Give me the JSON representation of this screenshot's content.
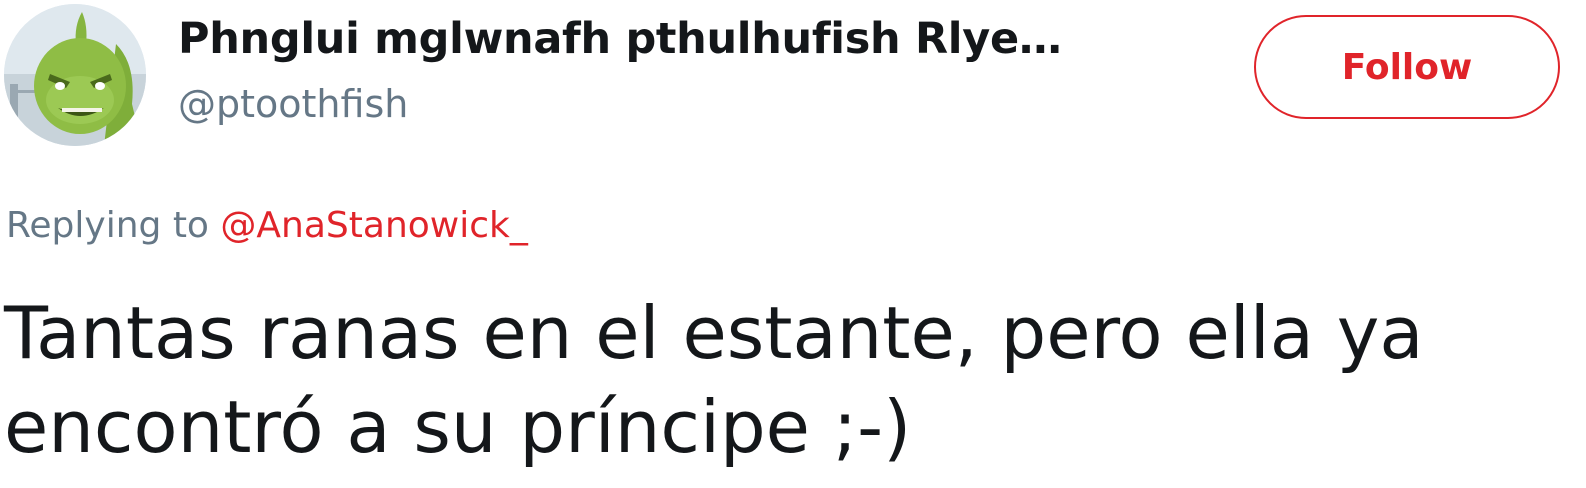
{
  "author": {
    "display_name": "Phnglui mglwnafh pthulhufish Rlye…",
    "handle": "@ptoothfish",
    "avatar_icon": "green-creature-avatar"
  },
  "follow_button": {
    "label": "Follow",
    "color": "#e0242a"
  },
  "reply": {
    "prefix": "Replying to",
    "mention": "@AnaStanowick_"
  },
  "tweet": {
    "text": "Tantas ranas en el estante, pero ella ya encontró a su príncipe ;-)"
  },
  "colors": {
    "accent": "#e0242a",
    "secondary_text": "#657786",
    "primary_text": "#14171a"
  }
}
